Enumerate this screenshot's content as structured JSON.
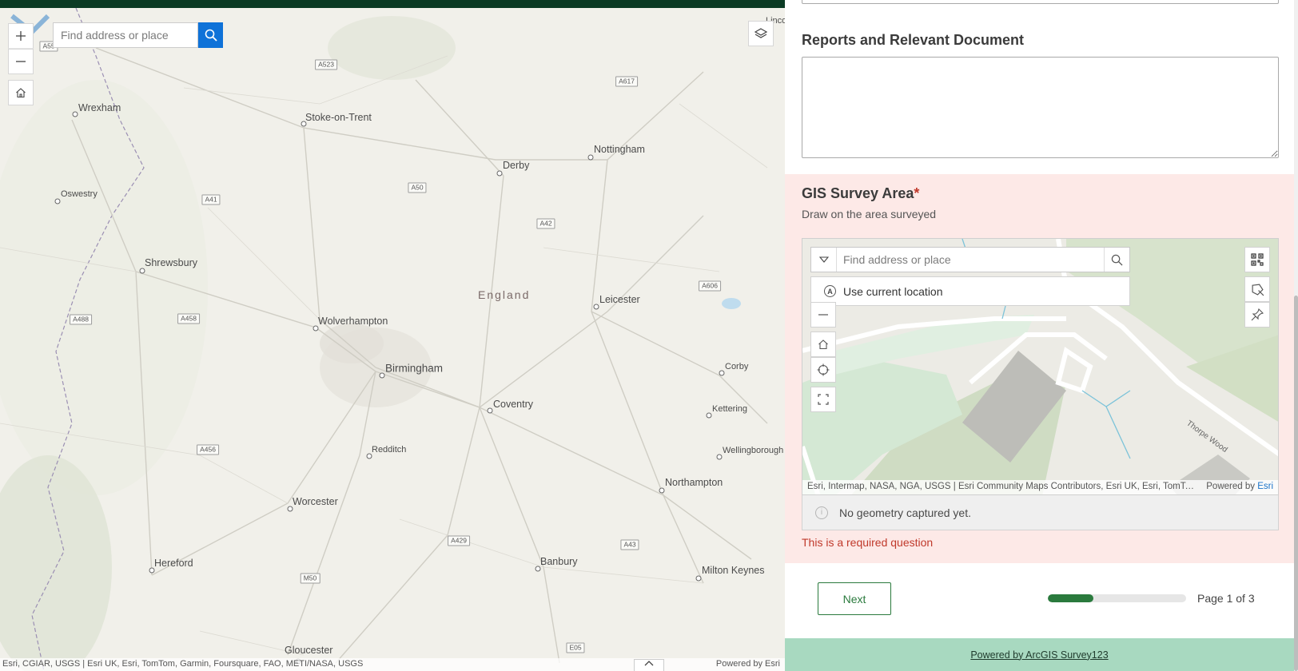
{
  "map": {
    "search_placeholder": "Find address or place",
    "attribution": "Esri, CGIAR, USGS | Esri UK, Esri, TomTom, Garmin, Foursquare, FAO, METI/NASA, USGS",
    "powered_by": "Powered by Esri",
    "edge_label": "Linco",
    "region": "England",
    "places": [
      {
        "name": "Wrexham"
      },
      {
        "name": "Stoke-on-Trent"
      },
      {
        "name": "Nottingham"
      },
      {
        "name": "Derby"
      },
      {
        "name": "Oswestry"
      },
      {
        "name": "Shrewsbury"
      },
      {
        "name": "Leicester"
      },
      {
        "name": "Wolverhampton"
      },
      {
        "name": "Birmingham"
      },
      {
        "name": "Corby"
      },
      {
        "name": "Coventry"
      },
      {
        "name": "Kettering"
      },
      {
        "name": "Redditch"
      },
      {
        "name": "Wellingborough"
      },
      {
        "name": "Northampton"
      },
      {
        "name": "Worcester"
      },
      {
        "name": "Hereford"
      },
      {
        "name": "Banbury"
      },
      {
        "name": "Milton Keynes"
      },
      {
        "name": "Gloucester"
      }
    ],
    "roads": [
      "A55",
      "A523",
      "A617",
      "A41",
      "A50",
      "A42",
      "A606",
      "A488",
      "A458",
      "A456",
      "A429",
      "A43",
      "M50",
      "E05"
    ],
    "icons": [
      "plus-icon",
      "minus-icon",
      "home-icon",
      "layers-icon",
      "search-icon",
      "chevron-up-icon"
    ]
  },
  "form": {
    "reports_label": "Reports and Relevant Document",
    "reports_value": "",
    "gis_label": "GIS Survey Area",
    "required_marker": "*",
    "gis_hint": "Draw on the area surveyed",
    "mini_map": {
      "search_placeholder": "Find address or place",
      "suggestion": "Use current location",
      "attribution": "Esri, Intermap, NASA, NGA, USGS | Esri Community Maps Contributors, Esri UK, Esri, TomTom, Garmin, Foursquare",
      "powered_prefix": "Powered by",
      "powered_link": "Esri",
      "street_label": "Thorpe Wood"
    },
    "geometry_message": "No geometry captured yet.",
    "required_message": "This is a required question",
    "next_label": "Next",
    "progress_fraction": 0.33,
    "page_indicator": "Page 1 of 3",
    "footer_link": "Powered by ArcGIS Survey123",
    "colors": {
      "accent": "#2a7a3d",
      "error": "#c0392b",
      "error_bg": "#fde9e7",
      "footer_bg": "#a8d9c0",
      "search_blue": "#0f72d8"
    }
  }
}
